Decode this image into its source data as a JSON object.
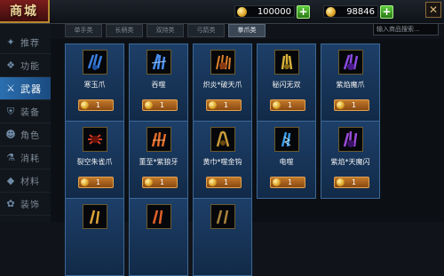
{
  "header": {
    "title": "商城",
    "currencies": [
      {
        "amount": "100000"
      },
      {
        "amount": "98846"
      }
    ],
    "close_glyph": "✕"
  },
  "sidebar": {
    "items": [
      {
        "label": "推荐",
        "icon": "star-icon",
        "active": false
      },
      {
        "label": "功能",
        "icon": "gift-icon",
        "active": false
      },
      {
        "label": "武器",
        "icon": "sword-icon",
        "active": true
      },
      {
        "label": "装备",
        "icon": "armor-icon",
        "active": false
      },
      {
        "label": "角色",
        "icon": "character-icon",
        "active": false
      },
      {
        "label": "消耗",
        "icon": "potion-icon",
        "active": false
      },
      {
        "label": "材料",
        "icon": "material-icon",
        "active": false
      },
      {
        "label": "装饰",
        "icon": "decoration-icon",
        "active": false
      }
    ]
  },
  "tabs": [
    {
      "label": "单手类",
      "active": false
    },
    {
      "label": "长柄类",
      "active": false
    },
    {
      "label": "双持类",
      "active": false
    },
    {
      "label": "弓箭类",
      "active": false
    },
    {
      "label": "拳爪类",
      "active": true
    }
  ],
  "search": {
    "placeholder": "输入商品搜索..."
  },
  "items": [
    {
      "name": "寒玉爪",
      "price": "1",
      "color": "#3a7fe0"
    },
    {
      "name": "吞噬",
      "price": "1",
      "color": "#4a8ef0"
    },
    {
      "name": "炽炎*破天爪",
      "price": "1",
      "color": "#e0822a"
    },
    {
      "name": "秘闪无双",
      "price": "1",
      "color": "#d8b23a"
    },
    {
      "name": "紫焰魔爪",
      "price": "1",
      "color": "#8a4ae0"
    },
    {
      "name": "裂空朱雀爪",
      "price": "1",
      "color": "#d83a2a"
    },
    {
      "name": "董至*紫狼牙",
      "price": "1",
      "color": "#e06a2a"
    },
    {
      "name": "黄巾*噬金钩",
      "price": "1",
      "color": "#c89a3a"
    },
    {
      "name": "电噬",
      "price": "1",
      "color": "#3a9ae8"
    },
    {
      "name": "紫焰*天魔闪",
      "price": "1",
      "color": "#9a4ad8"
    }
  ]
}
